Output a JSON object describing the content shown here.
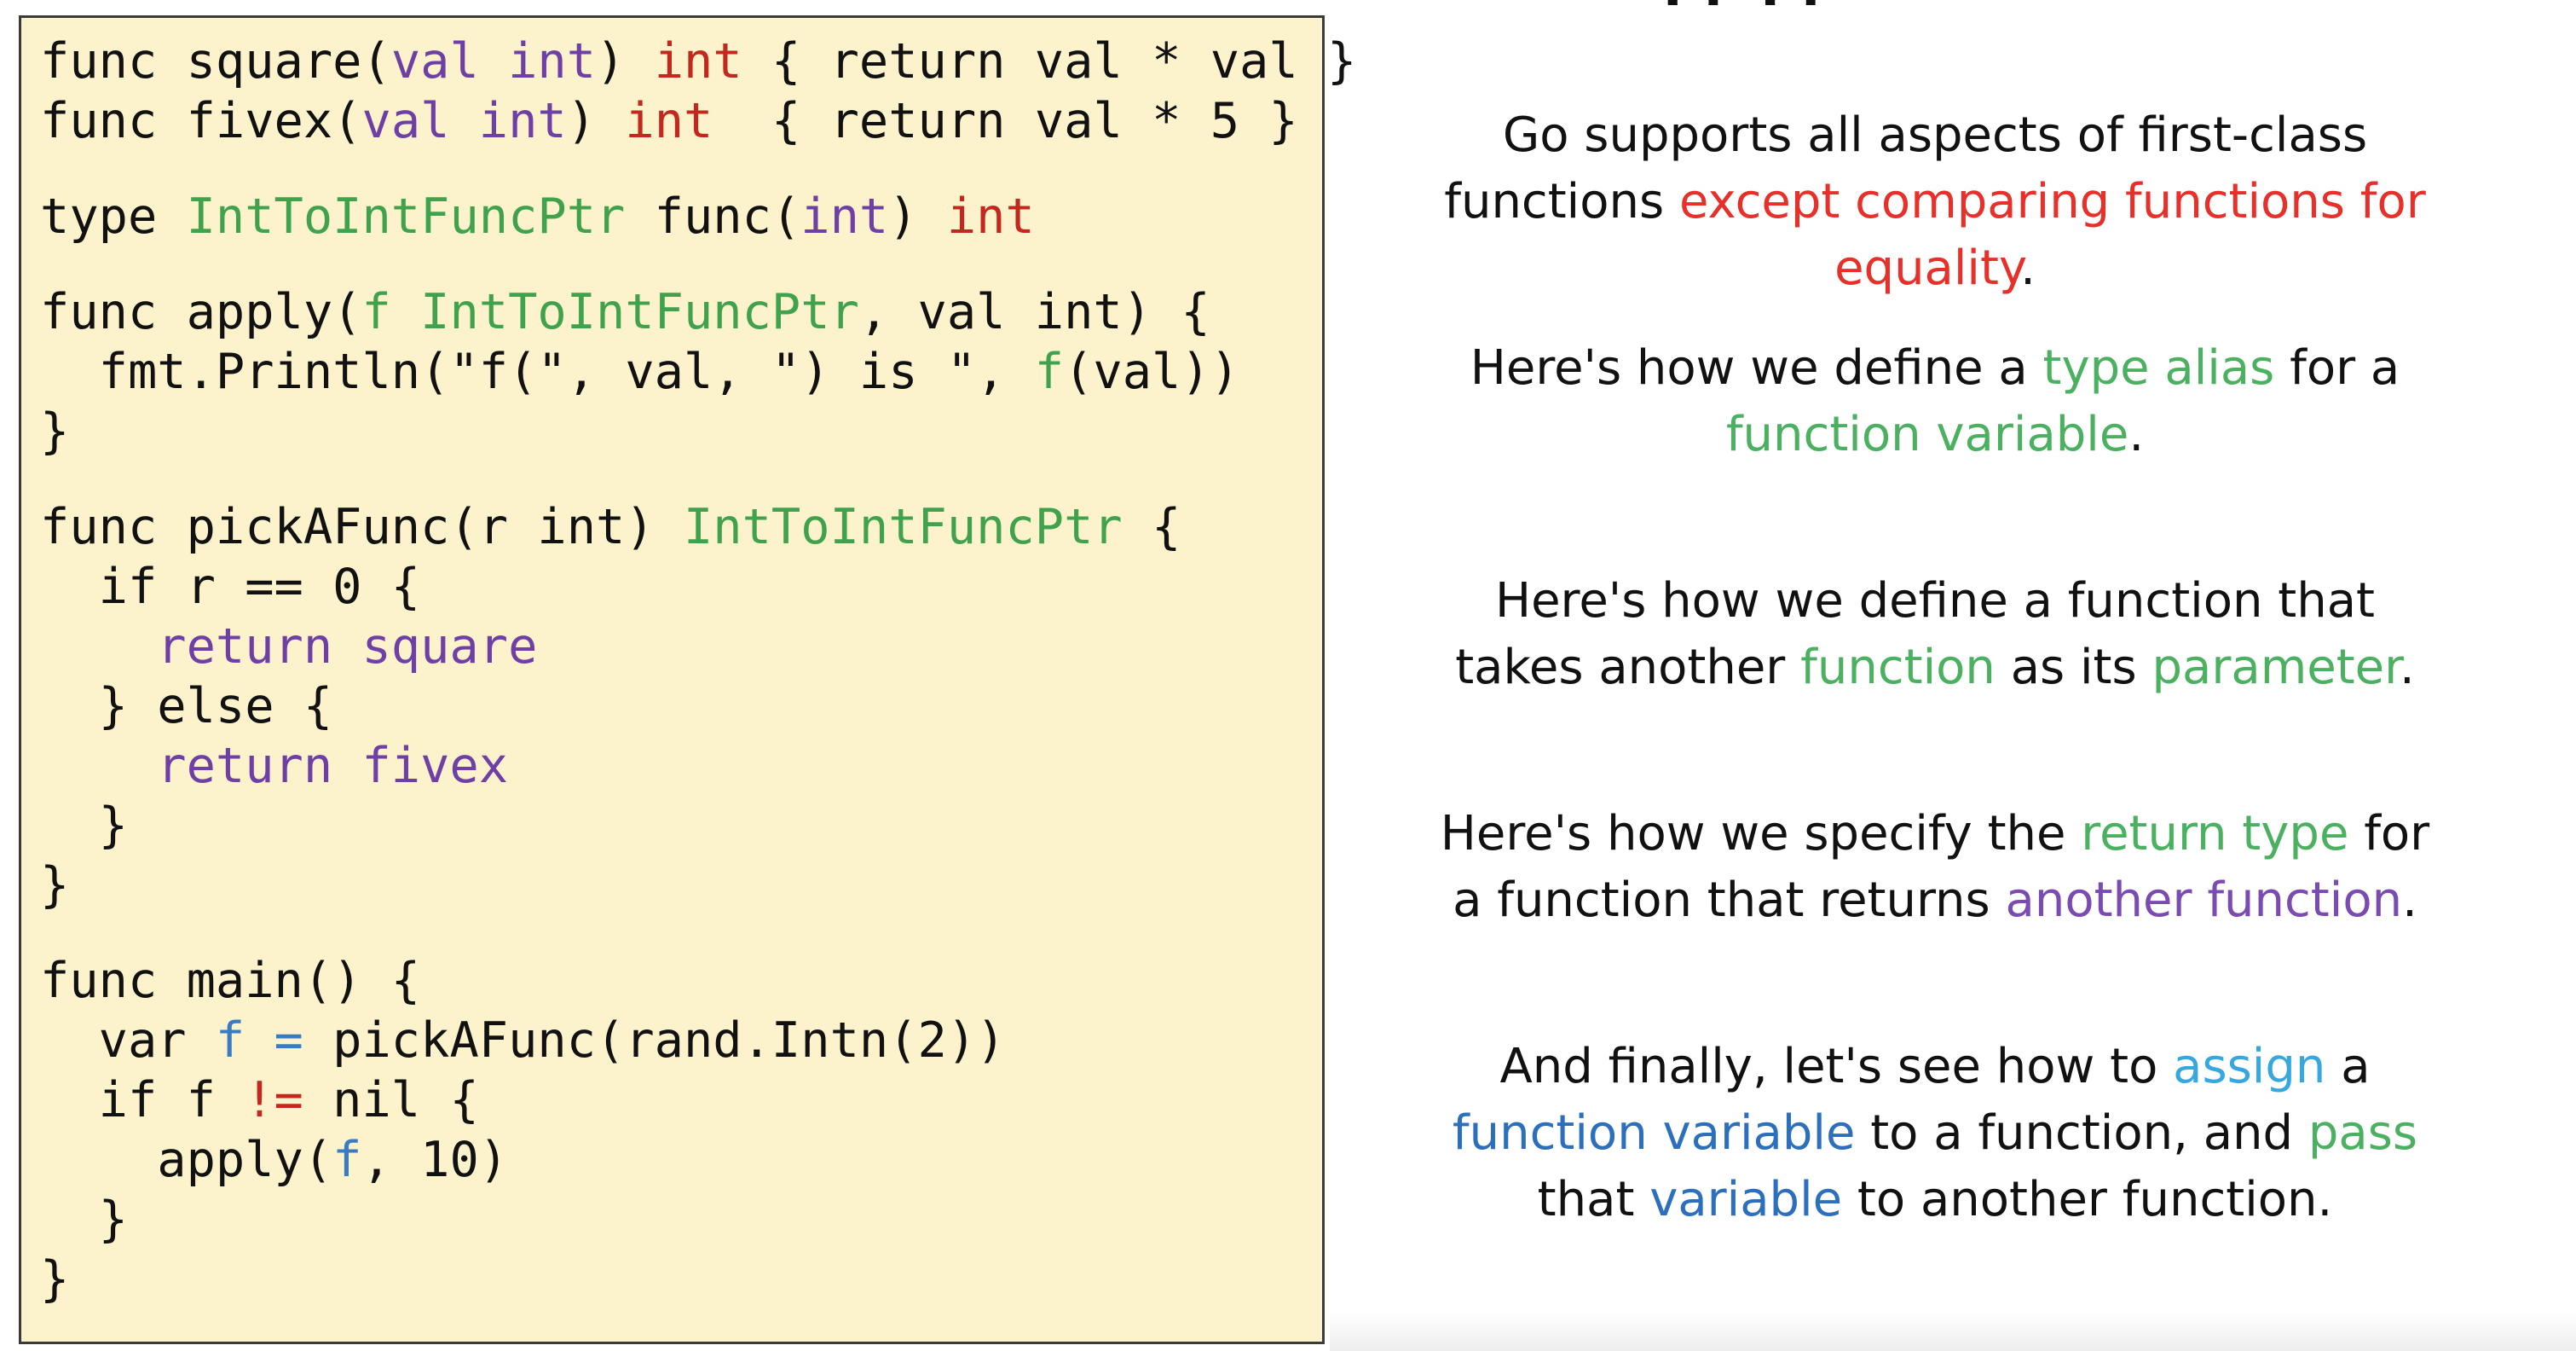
{
  "title_fragment": "g g",
  "code": {
    "l1a": "func square(",
    "l1b": "val",
    "l1c": " ",
    "l1d": "int",
    "l1e": ") ",
    "l1f": "int",
    "l1g": " { return val * val }",
    "l2a": "func fivex(",
    "l2b": "val",
    "l2c": " ",
    "l2d": "int",
    "l2e": ") ",
    "l2f": "int",
    "l2g": "  { return val * 5 }",
    "l3a": "type ",
    "l3b": "IntToIntFuncPtr",
    "l3c": " func(",
    "l3d": "int",
    "l3e": ") ",
    "l3f": "int",
    "l4a": "func apply(",
    "l4b": "f IntToIntFuncPtr",
    "l4c": ", val int) {",
    "l5a": "  fmt.Println(\"f(\", val, \") is \", ",
    "l5b": "f",
    "l5c": "(val))",
    "l6": "}",
    "l7a": "func pickAFunc(r int) ",
    "l7b": "IntToIntFuncPtr",
    "l7c": " {",
    "l8": "  if r == 0 {",
    "l9": "    return square",
    "l10": "  } else {",
    "l11": "    return fivex",
    "l12": "  }",
    "l13": "}",
    "l14": "func main() {",
    "l15a": "  var ",
    "l15b": "f =",
    "l15c": " pickAFunc(rand.Intn(2))",
    "l16a": "  if f ",
    "l16b": "!=",
    "l16c": " nil {",
    "l17a": "    apply(",
    "l17b": "f",
    "l17c": ", 10)",
    "l18": "  }",
    "l19": "}"
  },
  "notes": {
    "n1": {
      "a": "Go supports all aspects of first-class",
      "b": "functions ",
      "c": "except comparing functions for",
      "d": "equality",
      "e": "."
    },
    "n2": {
      "a": "Here's how we define a ",
      "b": "type alias",
      "c": " for a",
      "d": "function variable",
      "e": "."
    },
    "n3": {
      "a": "Here's how we define a function that",
      "b": "takes another ",
      "c": "function",
      "d": " as its ",
      "e": "parameter",
      "f": "."
    },
    "n4": {
      "a": "Here's how we specify the ",
      "b": "return type",
      "c": " for",
      "d": "a function that returns ",
      "e": "another function",
      "f": "."
    },
    "n5": {
      "a": "And finally, let's see how to ",
      "b": "assign",
      "c": " a",
      "d": "function variable",
      "e": " to a function, and ",
      "f": "pass",
      "g": "that ",
      "h": "variable",
      "i": " to another function."
    }
  },
  "colors": {
    "code_background": "#fcf2cc",
    "red": "#e8302a",
    "green": "#4bb160",
    "purple": "#7a4bb0",
    "light_blue": "#37a7df",
    "blue": "#2c6fbd"
  }
}
